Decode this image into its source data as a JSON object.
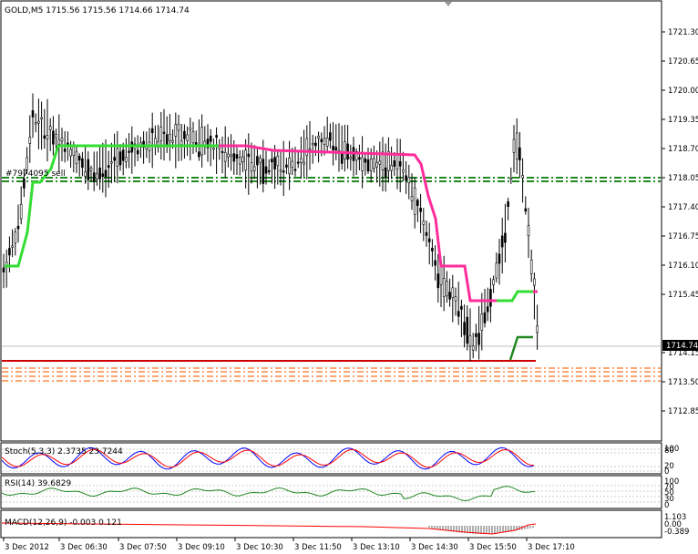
{
  "symbol_header": "GOLD,M5  1715.56 1715.56 1714.66 1714.74",
  "price_axis_ticks": [
    "1721.30",
    "1720.65",
    "1720.00",
    "1719.35",
    "1718.70",
    "1718.05",
    "1717.40",
    "1716.75",
    "1716.10",
    "1715.45",
    "1714.15",
    "1713.50",
    "1712.85"
  ],
  "current_price": "1714.74",
  "order_label": "#7974095 sell",
  "stoch_label": "Stoch(5,3,3) 2.3735 23.7244",
  "stoch_ticks": [
    "100",
    "80",
    "20",
    "0"
  ],
  "rsi_label": "RSI(14) 39.6829",
  "rsi_ticks": [
    "100",
    "70",
    "50",
    "30",
    "0"
  ],
  "macd_label": "MACD(12,26,9) -0.003 0.121",
  "macd_ticks": [
    "1.103",
    "0.00",
    "-0.389"
  ],
  "time_labels": [
    "3 Dec 2012",
    "3 Dec 06:30",
    "3 Dec 07:50",
    "3 Dec 09:10",
    "3 Dec 10:30",
    "3 Dec 11:50",
    "3 Dec 13:10",
    "3 Dec 14:30",
    "3 Dec 15:50",
    "3 Dec 17:10"
  ],
  "colors": {
    "background": "#ffffff",
    "indicator_bull": "#33dd33",
    "indicator_bear": "#ff2d9a",
    "order_line": "#228822",
    "support_line": "#cc0000",
    "level_dashes": "#ff8844",
    "candle": "#000000",
    "stoch_main": "#0000ff",
    "stoch_signal": "#ff0000",
    "rsi_line": "#228822",
    "macd_hist": "#b0b0b0",
    "macd_signal": "#ff0000"
  }
}
